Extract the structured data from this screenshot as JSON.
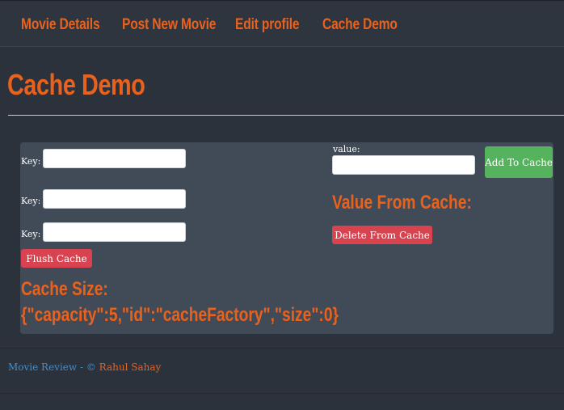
{
  "nav": {
    "items": [
      {
        "label": "Movie Details"
      },
      {
        "label": "Post New Movie"
      },
      {
        "label": "Edit profile"
      },
      {
        "label": "Cache Demo"
      }
    ]
  },
  "page": {
    "title": "Cache Demo"
  },
  "form": {
    "key_label": "Key:",
    "key_values": [
      "",
      "",
      ""
    ],
    "value_label": "value:",
    "value_input": "",
    "add_button": "Add To Cache",
    "flush_button": "Flush Cache",
    "delete_button": "Delete From Cache",
    "value_from_cache_label": "Value From Cache:",
    "cache_size_label": "Cache Size:",
    "cache_size_value": "{\"capacity\":5,\"id\":\"cacheFactory\",\"size\":0}"
  },
  "footer": {
    "site": "Movie Review",
    "separator": " - © ",
    "author": "Rahul Sahay"
  },
  "colors": {
    "accent": "#e8621e",
    "background": "#2c323b",
    "panel": "#414b57",
    "danger": "#d9434f",
    "success": "#55b35e",
    "link": "#3d8fd1"
  }
}
